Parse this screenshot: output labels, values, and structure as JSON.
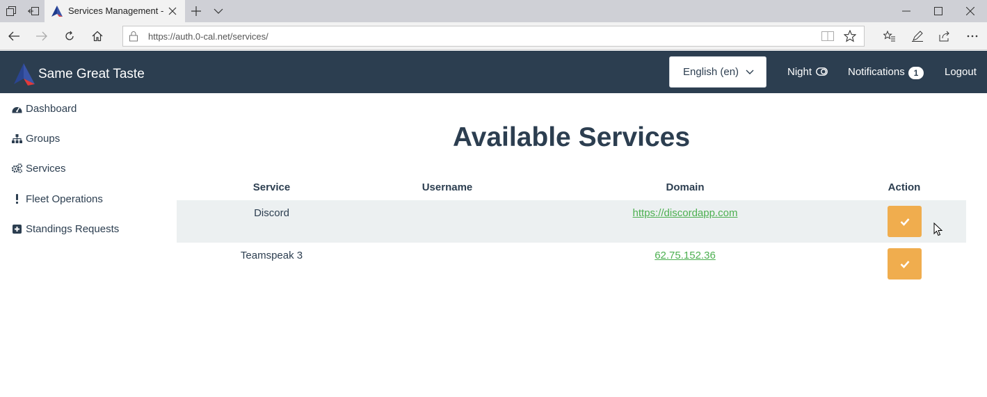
{
  "browser": {
    "tab_title": "Services Management -",
    "url": "https://auth.0-cal.net/services/"
  },
  "header": {
    "brand": "Same Great Taste",
    "language": "English (en)",
    "night_label": "Night",
    "notifications_label": "Notifications",
    "notifications_count": "1",
    "logout_label": "Logout"
  },
  "sidebar": {
    "items": [
      {
        "label": "Dashboard",
        "icon": "dashboard-icon"
      },
      {
        "label": "Groups",
        "icon": "sitemap-icon"
      },
      {
        "label": "Services",
        "icon": "cogs-icon"
      },
      {
        "label": "Fleet Operations",
        "icon": "exclamation-icon"
      },
      {
        "label": "Standings Requests",
        "icon": "plus-square-icon"
      }
    ]
  },
  "main": {
    "title": "Available Services",
    "columns": [
      "Service",
      "Username",
      "Domain",
      "Action"
    ],
    "rows": [
      {
        "service": "Discord",
        "username": "",
        "domain": "https://discordapp.com",
        "action_icon": "check-icon"
      },
      {
        "service": "Teamspeak 3",
        "username": "",
        "domain": "62.75.152.36",
        "action_icon": "check-icon"
      }
    ]
  },
  "colors": {
    "header_bg": "#2c3e50",
    "text": "#2c3e50",
    "link": "#4caf50",
    "action_button": "#f0ad4e",
    "striped_row": "#ecf0f1"
  }
}
